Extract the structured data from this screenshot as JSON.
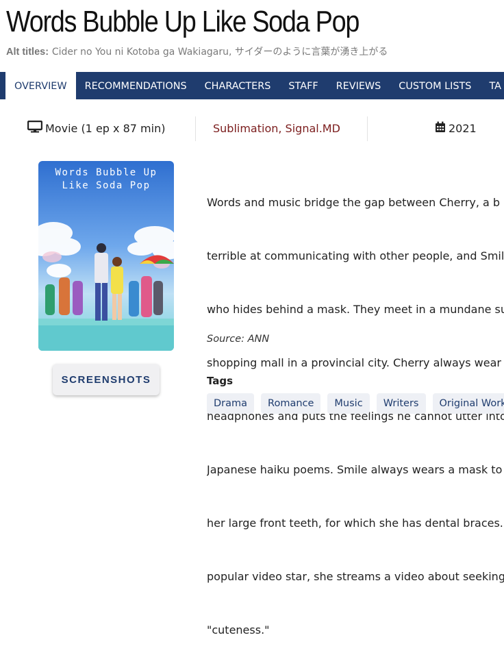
{
  "page": {
    "title": "Words Bubble Up Like Soda Pop",
    "alt_titles_label": "Alt titles:",
    "alt_titles_value": "Cider no You ni Kotoba ga Wakiagaru, サイダーのように言葉が湧き上がる"
  },
  "nav": {
    "tabs": [
      "OVERVIEW",
      "RECOMMENDATIONS",
      "CHARACTERS",
      "STAFF",
      "REVIEWS",
      "CUSTOM LISTS",
      "TA"
    ]
  },
  "info": {
    "format": "Movie (1 ep x 87 min)",
    "studios": "Sublimation, Signal.MD",
    "year": "2021"
  },
  "poster": {
    "title_line1": "Words Bubble Up",
    "title_line2": "Like Soda Pop"
  },
  "screenshots_button": "SCREENSHOTS",
  "synopsis": {
    "lines": [
      "Words and music bridge the gap between Cherry, a b",
      "terrible at communicating with other people, and Smil",
      "who hides behind a mask. They meet in a mundane su",
      "shopping mall in a provincial city. Cherry always wear",
      "headphones and puts the feelings he cannot utter into",
      "Japanese haiku poems. Smile always wears a mask to",
      "her large front teeth, for which she has dental braces.",
      "popular video star, she streams a video about seeking",
      "\"cuteness.\""
    ],
    "source": "Source: ANN"
  },
  "tags": {
    "label": "Tags",
    "items": [
      "Drama",
      "Romance",
      "Music",
      "Writers",
      "Original Work"
    ]
  },
  "colors": {
    "nav_bg": "#1f3c6e",
    "studio_link": "#7b1d1d",
    "tag_bg": "#eef0f5"
  }
}
